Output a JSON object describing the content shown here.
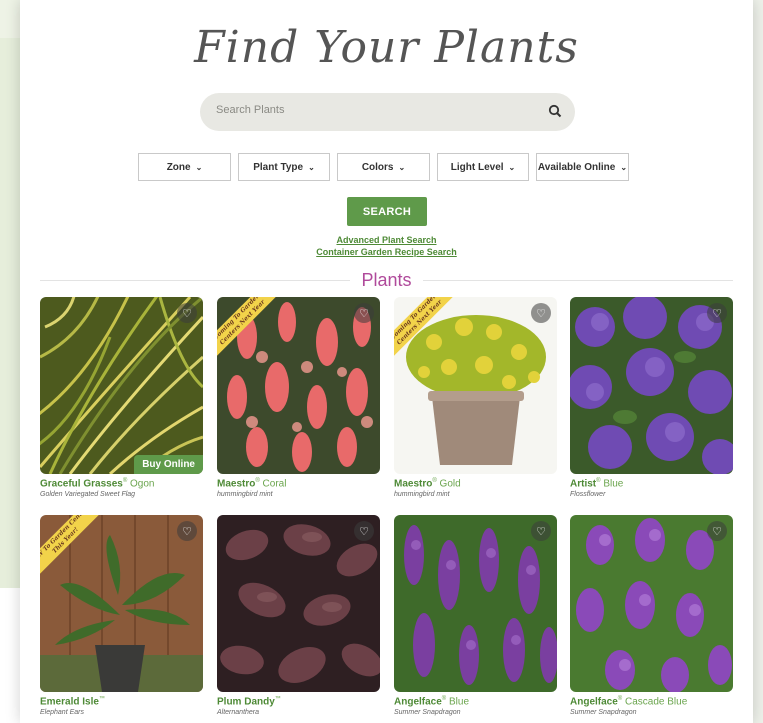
{
  "header": {
    "title": "Find Your Plants"
  },
  "search": {
    "placeholder": "Search Plants"
  },
  "filters": [
    {
      "label": "Zone"
    },
    {
      "label": "Plant Type"
    },
    {
      "label": "Colors"
    },
    {
      "label": "Light Level"
    },
    {
      "label": "Available Online"
    }
  ],
  "search_button": "SEARCH",
  "links": {
    "advanced": "Advanced Plant Search",
    "container": "Container Garden Recipe Search"
  },
  "section_title": "Plants",
  "plants": [
    {
      "name_bold": "Graceful Grasses",
      "mark": "®",
      "name_rest": " Ogon",
      "sub": "Golden Variegated Sweet Flag",
      "badge": "Buy Online",
      "banner": ""
    },
    {
      "name_bold": "Maestro",
      "mark": "®",
      "name_rest": " Coral",
      "sub": "hummingbird mint",
      "badge": "",
      "banner": "Coming To Garden Centers Next Year"
    },
    {
      "name_bold": "Maestro",
      "mark": "®",
      "name_rest": " Gold",
      "sub": "hummingbird mint",
      "badge": "",
      "banner": "Coming To Garden Centers Next Year"
    },
    {
      "name_bold": "Artist",
      "mark": "®",
      "name_rest": " Blue",
      "sub": "Flossflower",
      "badge": "",
      "banner": ""
    },
    {
      "name_bold": "Emerald Isle",
      "mark": "™",
      "name_rest": "",
      "sub": "Elephant Ears",
      "badge": "",
      "banner": "NEW To Garden Centers This Year!"
    },
    {
      "name_bold": "Plum Dandy",
      "mark": "™",
      "name_rest": "",
      "sub": "Alternanthera",
      "badge": "",
      "banner": ""
    },
    {
      "name_bold": "Angelface",
      "mark": "®",
      "name_rest": " Blue",
      "sub": "Summer Snapdragon",
      "badge": "",
      "banner": ""
    },
    {
      "name_bold": "Angelface",
      "mark": "®",
      "name_rest": " Cascade Blue",
      "sub": "Summer Snapdragon",
      "badge": "",
      "banner": ""
    }
  ],
  "colors": {
    "accent_green": "#5f9a4a",
    "section_purple": "#b04a9b"
  }
}
